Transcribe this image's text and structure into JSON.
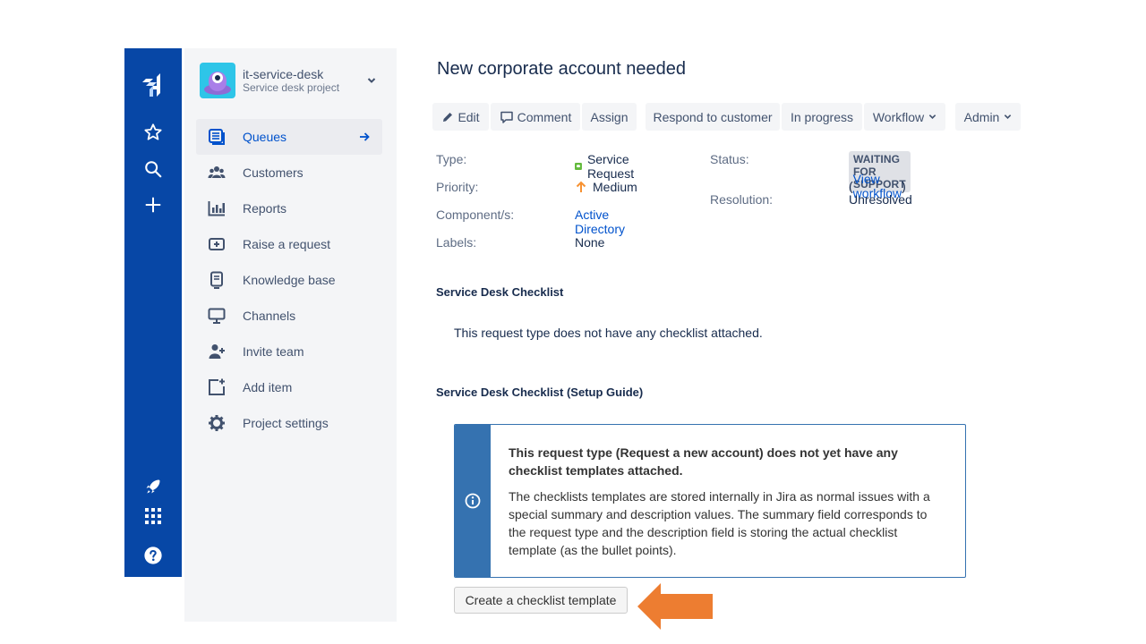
{
  "project": {
    "name": "it-service-desk",
    "type": "Service desk project"
  },
  "sidebar": {
    "items": [
      {
        "label": "Queues",
        "icon": "queues-icon",
        "active": true
      },
      {
        "label": "Customers",
        "icon": "customers-icon"
      },
      {
        "label": "Reports",
        "icon": "reports-icon"
      },
      {
        "label": "Raise a request",
        "icon": "raise-request-icon"
      },
      {
        "label": "Knowledge base",
        "icon": "knowledge-base-icon"
      },
      {
        "label": "Channels",
        "icon": "channels-icon"
      },
      {
        "label": "Invite team",
        "icon": "invite-team-icon"
      },
      {
        "label": "Add item",
        "icon": "add-item-icon"
      },
      {
        "label": "Project settings",
        "icon": "gear-icon"
      }
    ]
  },
  "issue": {
    "title": "New corporate account needed"
  },
  "toolbar": {
    "edit": "Edit",
    "comment": "Comment",
    "assign": "Assign",
    "respond": "Respond to customer",
    "in_progress": "In progress",
    "workflow": "Workflow",
    "admin": "Admin"
  },
  "details": {
    "type_label": "Type:",
    "type_value": "Service Request",
    "priority_label": "Priority:",
    "priority_value": "Medium",
    "component_label": "Component/s:",
    "component_value": "Active Directory",
    "labels_label": "Labels:",
    "labels_value": "None",
    "status_label": "Status:",
    "status_value": "WAITING FOR SUPPORT",
    "view_workflow": "View workflow",
    "resolution_label": "Resolution:",
    "resolution_value": "Unresolved"
  },
  "checklist": {
    "title": "Service Desk Checklist",
    "empty_text": "This request type does not have any checklist attached."
  },
  "setup_guide": {
    "title": "Service Desk Checklist (Setup Guide)",
    "info_title": "This request type (Request a new account) does not yet have any checklist templates attached.",
    "info_body": "The checklists templates are stored internally in Jira as normal issues with a special summary and description values. The summary field corresponds to the request type and the description field is storing the actual checklist template (as the bullet points).",
    "create_button": "Create a checklist template"
  },
  "colors": {
    "global_nav": "#0747a6",
    "sidebar_bg": "#f4f5f7",
    "link": "#0052cc",
    "info_bar": "#3572b0",
    "annotation_arrow": "#ed7d31"
  }
}
